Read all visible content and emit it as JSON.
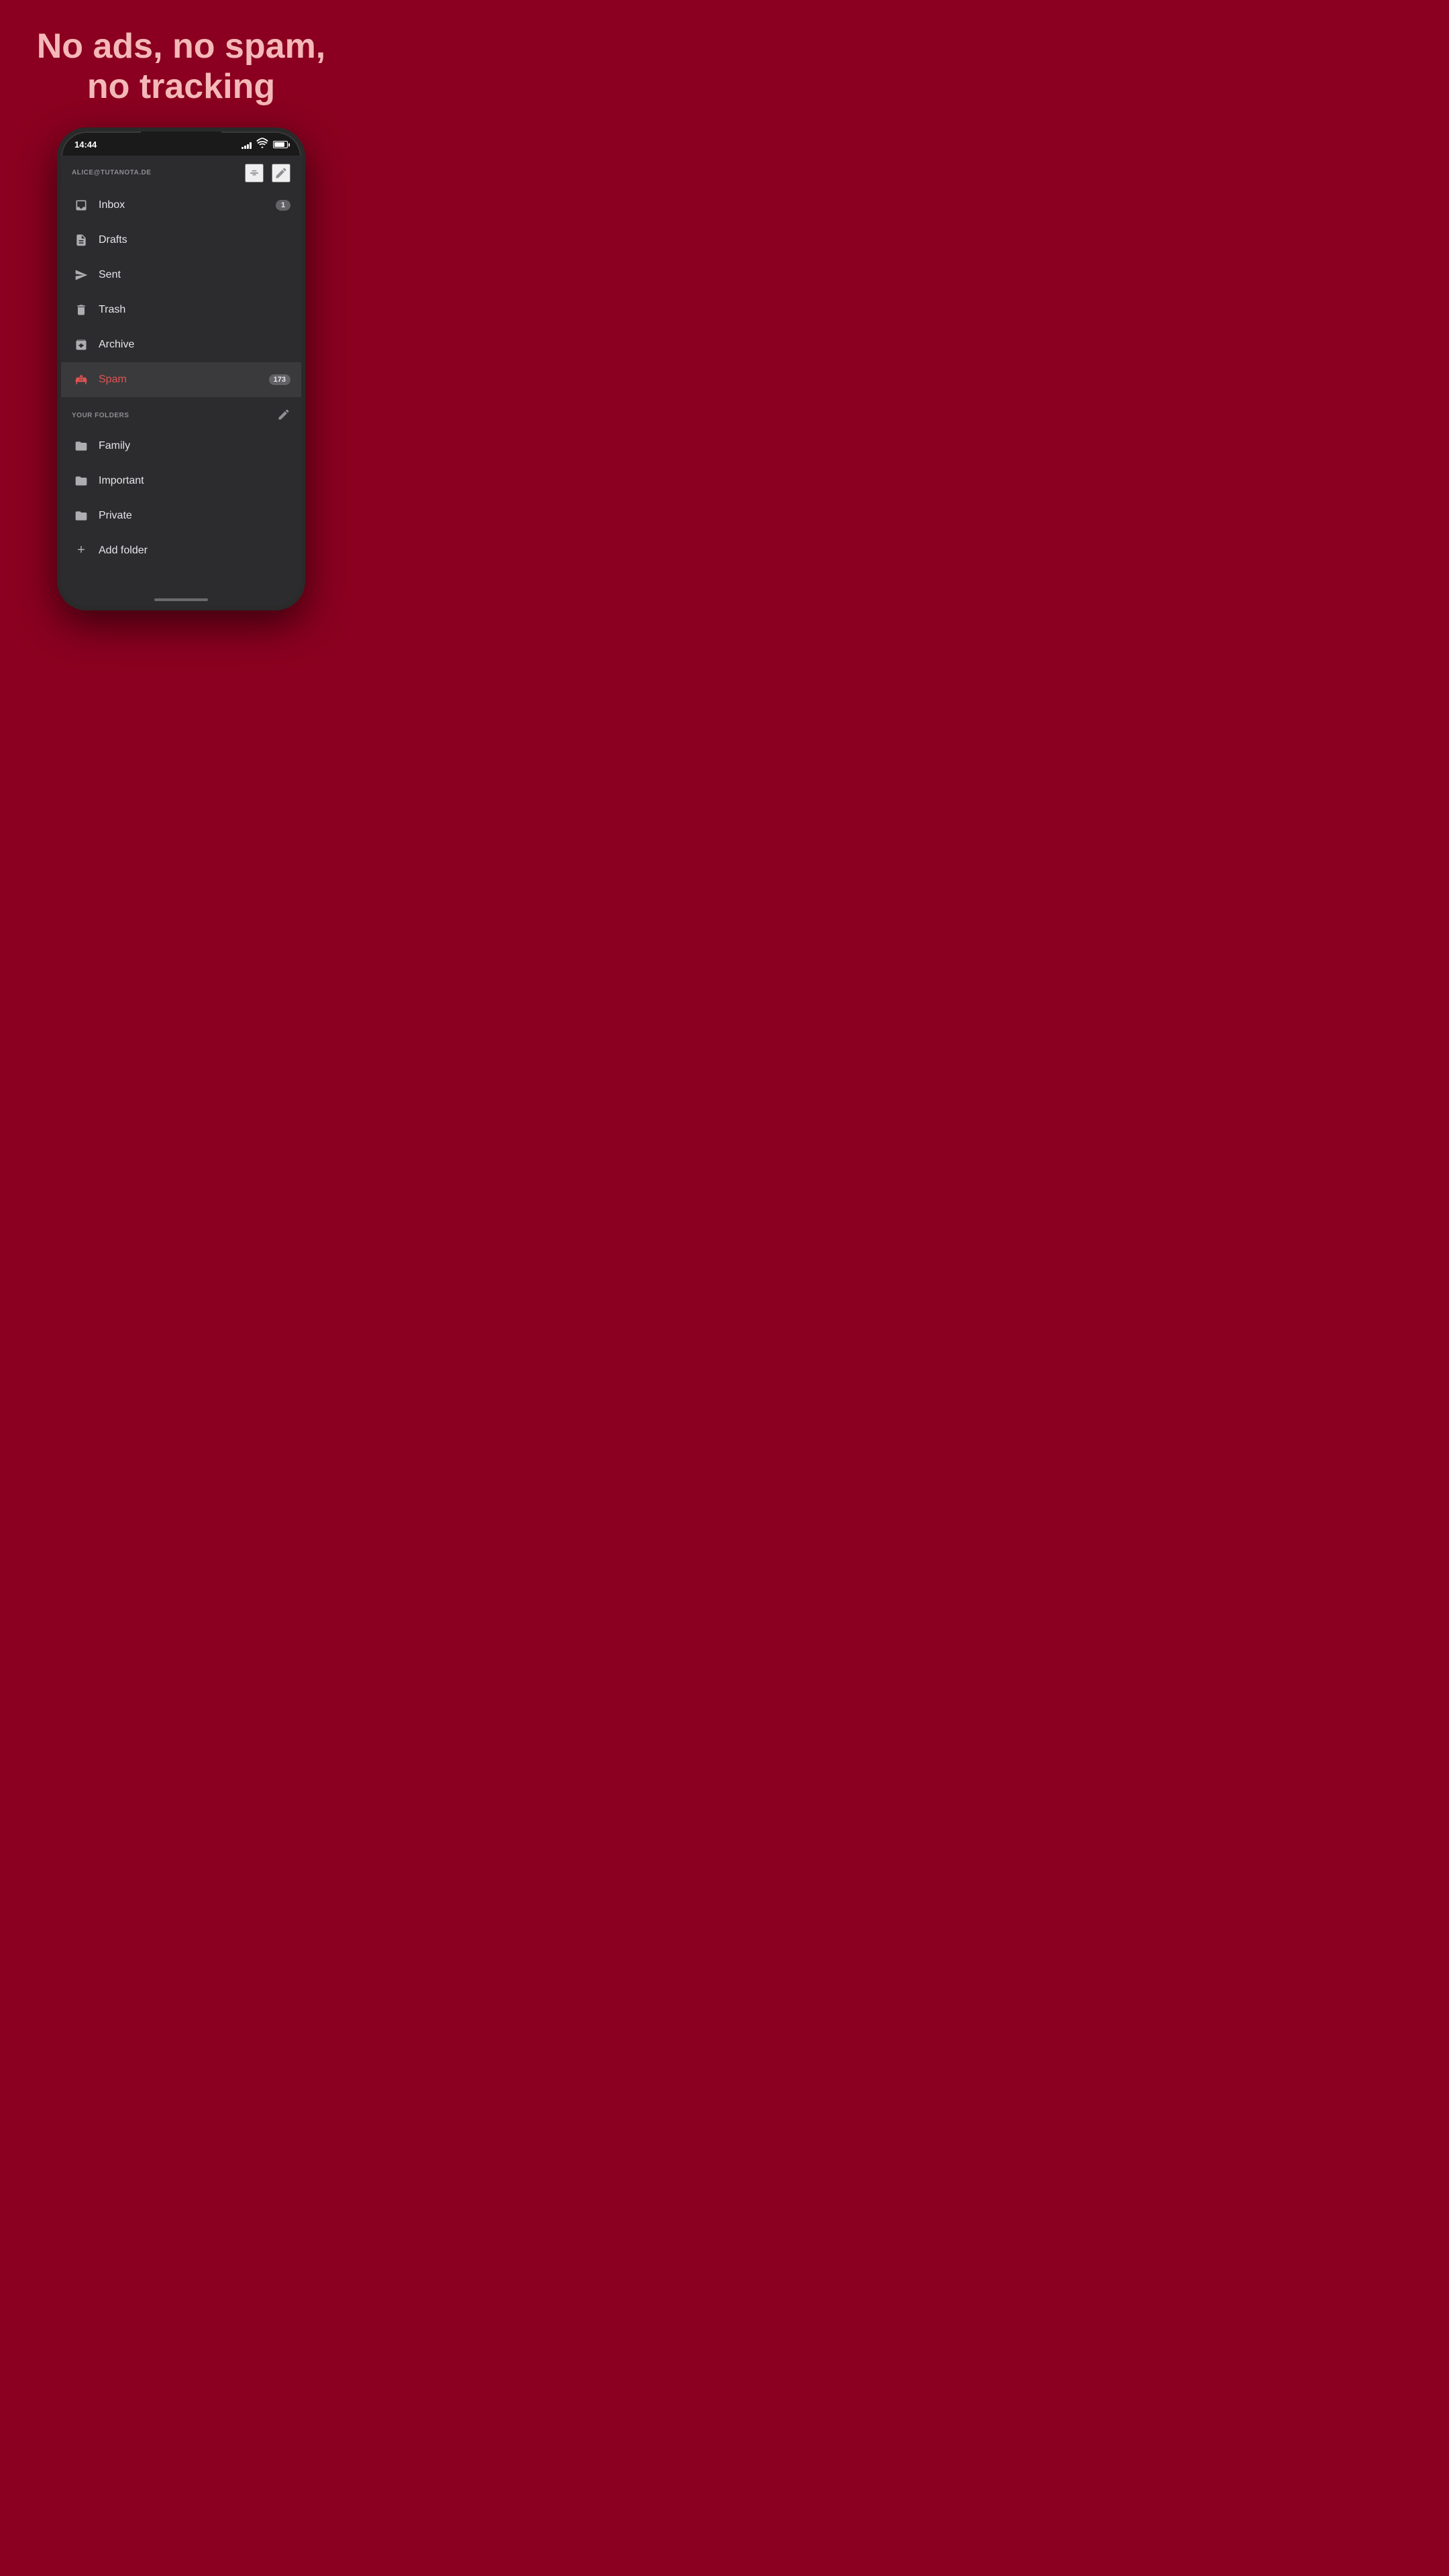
{
  "headline": {
    "line1": "No ads, no spam,",
    "line2": "no tracking"
  },
  "statusBar": {
    "time": "14:44"
  },
  "app": {
    "account": "ALICE@TUTANOTA.DE",
    "menuItems": [
      {
        "id": "inbox",
        "label": "Inbox",
        "badge": "1",
        "active": false
      },
      {
        "id": "drafts",
        "label": "Drafts",
        "badge": null,
        "active": false
      },
      {
        "id": "sent",
        "label": "Sent",
        "badge": null,
        "active": false
      },
      {
        "id": "trash",
        "label": "Trash",
        "badge": null,
        "active": false
      },
      {
        "id": "archive",
        "label": "Archive",
        "badge": null,
        "active": false
      },
      {
        "id": "spam",
        "label": "Spam",
        "badge": "173",
        "active": true
      }
    ],
    "foldersSection": {
      "title": "YOUR FOLDERS",
      "folders": [
        {
          "id": "family",
          "label": "Family"
        },
        {
          "id": "important",
          "label": "Important"
        },
        {
          "id": "private",
          "label": "Private"
        }
      ],
      "addFolderLabel": "Add folder"
    }
  }
}
